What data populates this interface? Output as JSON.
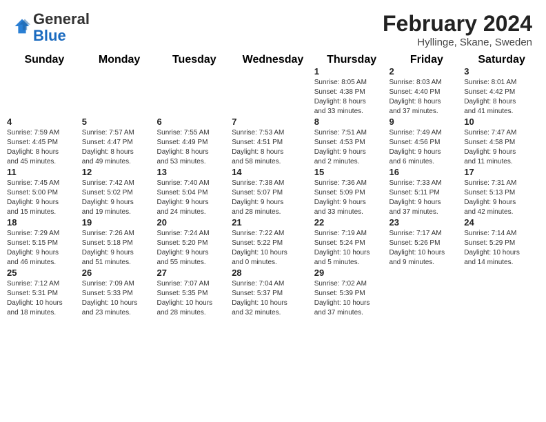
{
  "header": {
    "logo_general": "General",
    "logo_blue": "Blue",
    "month_year": "February 2024",
    "location": "Hyllinge, Skane, Sweden"
  },
  "weekdays": [
    "Sunday",
    "Monday",
    "Tuesday",
    "Wednesday",
    "Thursday",
    "Friday",
    "Saturday"
  ],
  "weeks": [
    [
      {
        "day": "",
        "info": ""
      },
      {
        "day": "",
        "info": ""
      },
      {
        "day": "",
        "info": ""
      },
      {
        "day": "",
        "info": ""
      },
      {
        "day": "1",
        "info": "Sunrise: 8:05 AM\nSunset: 4:38 PM\nDaylight: 8 hours\nand 33 minutes."
      },
      {
        "day": "2",
        "info": "Sunrise: 8:03 AM\nSunset: 4:40 PM\nDaylight: 8 hours\nand 37 minutes."
      },
      {
        "day": "3",
        "info": "Sunrise: 8:01 AM\nSunset: 4:42 PM\nDaylight: 8 hours\nand 41 minutes."
      }
    ],
    [
      {
        "day": "4",
        "info": "Sunrise: 7:59 AM\nSunset: 4:45 PM\nDaylight: 8 hours\nand 45 minutes."
      },
      {
        "day": "5",
        "info": "Sunrise: 7:57 AM\nSunset: 4:47 PM\nDaylight: 8 hours\nand 49 minutes."
      },
      {
        "day": "6",
        "info": "Sunrise: 7:55 AM\nSunset: 4:49 PM\nDaylight: 8 hours\nand 53 minutes."
      },
      {
        "day": "7",
        "info": "Sunrise: 7:53 AM\nSunset: 4:51 PM\nDaylight: 8 hours\nand 58 minutes."
      },
      {
        "day": "8",
        "info": "Sunrise: 7:51 AM\nSunset: 4:53 PM\nDaylight: 9 hours\nand 2 minutes."
      },
      {
        "day": "9",
        "info": "Sunrise: 7:49 AM\nSunset: 4:56 PM\nDaylight: 9 hours\nand 6 minutes."
      },
      {
        "day": "10",
        "info": "Sunrise: 7:47 AM\nSunset: 4:58 PM\nDaylight: 9 hours\nand 11 minutes."
      }
    ],
    [
      {
        "day": "11",
        "info": "Sunrise: 7:45 AM\nSunset: 5:00 PM\nDaylight: 9 hours\nand 15 minutes."
      },
      {
        "day": "12",
        "info": "Sunrise: 7:42 AM\nSunset: 5:02 PM\nDaylight: 9 hours\nand 19 minutes."
      },
      {
        "day": "13",
        "info": "Sunrise: 7:40 AM\nSunset: 5:04 PM\nDaylight: 9 hours\nand 24 minutes."
      },
      {
        "day": "14",
        "info": "Sunrise: 7:38 AM\nSunset: 5:07 PM\nDaylight: 9 hours\nand 28 minutes."
      },
      {
        "day": "15",
        "info": "Sunrise: 7:36 AM\nSunset: 5:09 PM\nDaylight: 9 hours\nand 33 minutes."
      },
      {
        "day": "16",
        "info": "Sunrise: 7:33 AM\nSunset: 5:11 PM\nDaylight: 9 hours\nand 37 minutes."
      },
      {
        "day": "17",
        "info": "Sunrise: 7:31 AM\nSunset: 5:13 PM\nDaylight: 9 hours\nand 42 minutes."
      }
    ],
    [
      {
        "day": "18",
        "info": "Sunrise: 7:29 AM\nSunset: 5:15 PM\nDaylight: 9 hours\nand 46 minutes."
      },
      {
        "day": "19",
        "info": "Sunrise: 7:26 AM\nSunset: 5:18 PM\nDaylight: 9 hours\nand 51 minutes."
      },
      {
        "day": "20",
        "info": "Sunrise: 7:24 AM\nSunset: 5:20 PM\nDaylight: 9 hours\nand 55 minutes."
      },
      {
        "day": "21",
        "info": "Sunrise: 7:22 AM\nSunset: 5:22 PM\nDaylight: 10 hours\nand 0 minutes."
      },
      {
        "day": "22",
        "info": "Sunrise: 7:19 AM\nSunset: 5:24 PM\nDaylight: 10 hours\nand 5 minutes."
      },
      {
        "day": "23",
        "info": "Sunrise: 7:17 AM\nSunset: 5:26 PM\nDaylight: 10 hours\nand 9 minutes."
      },
      {
        "day": "24",
        "info": "Sunrise: 7:14 AM\nSunset: 5:29 PM\nDaylight: 10 hours\nand 14 minutes."
      }
    ],
    [
      {
        "day": "25",
        "info": "Sunrise: 7:12 AM\nSunset: 5:31 PM\nDaylight: 10 hours\nand 18 minutes."
      },
      {
        "day": "26",
        "info": "Sunrise: 7:09 AM\nSunset: 5:33 PM\nDaylight: 10 hours\nand 23 minutes."
      },
      {
        "day": "27",
        "info": "Sunrise: 7:07 AM\nSunset: 5:35 PM\nDaylight: 10 hours\nand 28 minutes."
      },
      {
        "day": "28",
        "info": "Sunrise: 7:04 AM\nSunset: 5:37 PM\nDaylight: 10 hours\nand 32 minutes."
      },
      {
        "day": "29",
        "info": "Sunrise: 7:02 AM\nSunset: 5:39 PM\nDaylight: 10 hours\nand 37 minutes."
      },
      {
        "day": "",
        "info": ""
      },
      {
        "day": "",
        "info": ""
      }
    ]
  ]
}
